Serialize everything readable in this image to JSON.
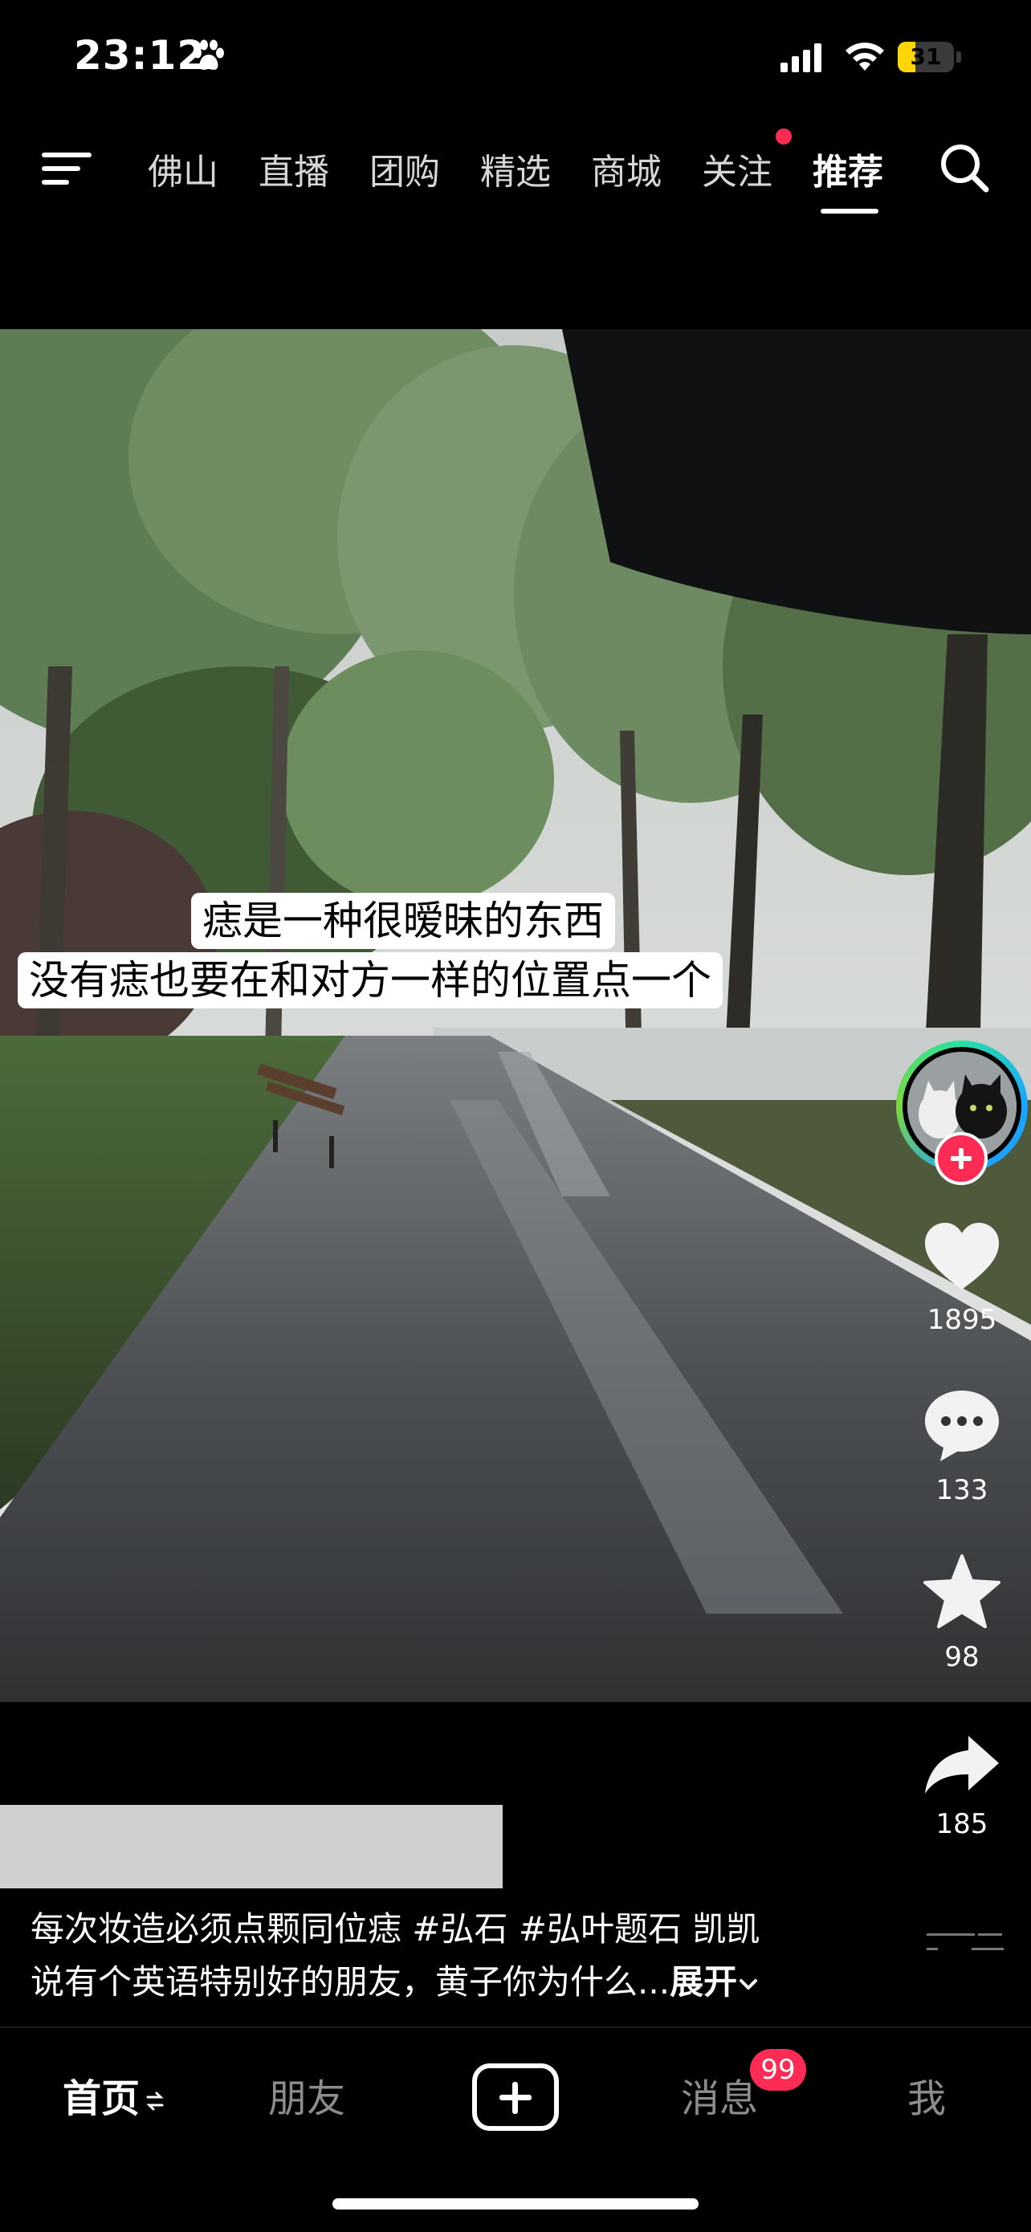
{
  "status_bar": {
    "time": "23:12",
    "battery": "31",
    "battery_level": 0.31
  },
  "top_nav": {
    "tabs": [
      {
        "label": "佛山"
      },
      {
        "label": "直播"
      },
      {
        "label": "团购"
      },
      {
        "label": "精选"
      },
      {
        "label": "商城"
      },
      {
        "label": "关注"
      },
      {
        "label": "推荐"
      }
    ],
    "active_tab": "推荐",
    "dot_tab": "关注"
  },
  "video": {
    "caption_line1": "痣是一种很暧昧的东西",
    "caption_line2": "没有痣也要在和对方一样的位置点一个"
  },
  "right_rail": {
    "likes": "1895",
    "comments": "133",
    "favorites": "98",
    "shares": "185"
  },
  "description": {
    "line1": "每次妆造必须点颗同位痣 #弘石 #弘叶题石 凯凯",
    "line2": "说有个英语特别好的朋友，黄子你为什么...",
    "expand_label": "展开"
  },
  "bottom_nav": {
    "home": "首页",
    "friends": "朋友",
    "messages": "消息",
    "messages_badge": "99",
    "me": "我"
  },
  "colors": {
    "accent": "#fe2c55",
    "battery": "#ffd60a"
  }
}
